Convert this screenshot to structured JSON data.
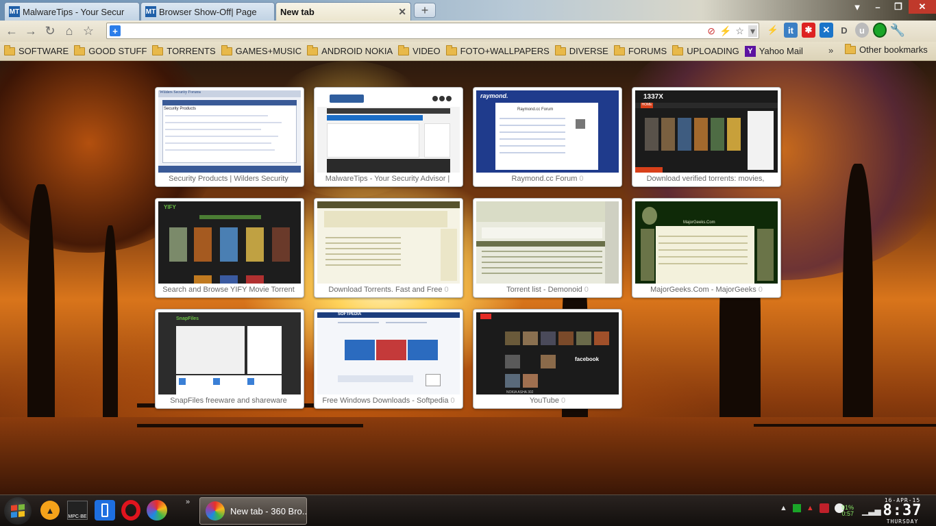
{
  "tabs": [
    {
      "title": "MalwareTips - Your Secur",
      "favicon": "MT",
      "active": false
    },
    {
      "title": "Browser Show-Off| Page",
      "favicon": "MT",
      "active": false
    },
    {
      "title": "New tab",
      "favicon": "",
      "active": true
    }
  ],
  "new_tab_symbol": "+",
  "window_controls": {
    "minimize": "–",
    "maximize": "❐",
    "close": "✕"
  },
  "toolbar": {
    "back": "←",
    "forward": "→",
    "reload": "↻",
    "home": "⌂",
    "star": "☆",
    "omnibox_value": ""
  },
  "bookmarks": [
    {
      "label": "SOFTWARE",
      "type": "folder"
    },
    {
      "label": "GOOD STUFF",
      "type": "folder"
    },
    {
      "label": "TORRENTS",
      "type": "folder"
    },
    {
      "label": "GAMES+MUSIC",
      "type": "folder"
    },
    {
      "label": "ANDROID NOKIA",
      "type": "folder"
    },
    {
      "label": "VIDEO",
      "type": "folder"
    },
    {
      "label": "FOTO+WALLPAPERS",
      "type": "folder"
    },
    {
      "label": "DIVERSE",
      "type": "folder"
    },
    {
      "label": "FORUMS",
      "type": "folder"
    },
    {
      "label": "UPLOADING",
      "type": "folder"
    },
    {
      "label": "Yahoo Mail",
      "type": "yahoo"
    }
  ],
  "bookmarks_overflow": "»",
  "other_bookmarks": "Other bookmarks",
  "thumbnails": [
    {
      "caption": "Security Products | Wilders Security",
      "count": "",
      "theme": "wilders"
    },
    {
      "caption": "MalwareTips - Your Security Advisor |",
      "count": "",
      "theme": "malwaretips"
    },
    {
      "caption": "Raymond.cc Forum",
      "count": "0",
      "theme": "raymond"
    },
    {
      "caption": "Download verified torrents: movies,",
      "count": "",
      "theme": "1337x"
    },
    {
      "caption": "Search and Browse YIFY Movie Torrent",
      "count": "",
      "theme": "yify"
    },
    {
      "caption": "Download Torrents. Fast and Free",
      "count": "0",
      "theme": "torrentz"
    },
    {
      "caption": "Torrent list - Demonoid",
      "count": "0",
      "theme": "demonoid"
    },
    {
      "caption": "MajorGeeks.Com - MajorGeeks",
      "count": "0",
      "theme": "majorgeeks"
    },
    {
      "caption": "SnapFiles freeware and shareware",
      "count": "",
      "theme": "snapfiles"
    },
    {
      "caption": "Free Windows Downloads - Softpedia",
      "count": "0",
      "theme": "softpedia"
    },
    {
      "caption": "YouTube",
      "count": "0",
      "theme": "youtube"
    }
  ],
  "thumbnail_text": {
    "wilders_title": "Wilders Security Forums",
    "wilders_heading": "Security Products",
    "raymond_logo": "raymond.",
    "raymond_forum": "Raymond.cc Forum",
    "leet_logo": "1337X",
    "leet_tab": "HOME",
    "yify_logo": "YIFY",
    "majorgeeks_header": "MajorGeeks.Com",
    "snapfiles_logo": "SnapFiles",
    "softpedia_logo": "SOFTPEDIA",
    "youtube_promo": "facebook",
    "youtube_footer": "NOKIA ASHA 302"
  },
  "taskbar": {
    "mpc_label": "MPC·BE",
    "task_title": "New tab - 360 Bro...",
    "overflow": "»",
    "battery_pct": "91%",
    "battery_time": "0:57",
    "date": "16-APR-15",
    "time": "8:37",
    "day": "THURSDAY"
  }
}
